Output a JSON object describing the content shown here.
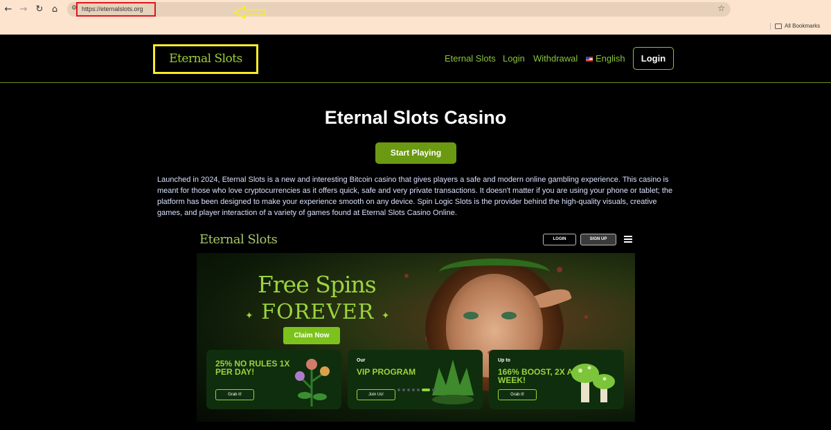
{
  "browser": {
    "url": "https://eternalslots.org",
    "bookmarks_label": "All Bookmarks"
  },
  "header": {
    "logo": "Eternal Slots",
    "nav": [
      "Eternal Slots",
      "Login",
      "Withdrawal",
      "English"
    ],
    "login_button": "Login"
  },
  "hero": {
    "title": "Eternal Slots Casino",
    "start_button": "Start Playing",
    "intro": "Launched in 2024, Eternal Slots is a new and interesting Bitcoin casino that gives players a safe and modern online gambling experience. This casino is meant for those who love cryptocurrencies as it offers quick, safe and very private transactions. It doesn't matter if you are using your phone or tablet; the platform has been designed to make your experience smooth on any device. Spin Logic Slots is the provider behind the high-quality visuals, creative games, and player interaction of a variety of games found at Eternal Slots Casino Online."
  },
  "preview": {
    "logo": "Eternal Slots",
    "login": "LOGIN",
    "signup": "SIGN UP",
    "headline": "Free Spins",
    "subheadline": "FOREVER",
    "claim_button": "Claim Now",
    "promos": [
      {
        "small": "",
        "main": "25% NO RULES 1X PER DAY!",
        "button": "Grab it!"
      },
      {
        "small": "Our",
        "main": "VIP PROGRAM",
        "button": "Join Us!"
      },
      {
        "small": "Up to",
        "main": "166% BOOST, 2X A WEEK!",
        "button": "Grab it!"
      }
    ],
    "carousel_active_index": 5,
    "carousel_count": 7
  },
  "colors": {
    "accent": "#8cc43c",
    "highlight_box": "#f7ec2a",
    "url_highlight": "#e0141b",
    "chrome_bg": "#fde4cf"
  }
}
